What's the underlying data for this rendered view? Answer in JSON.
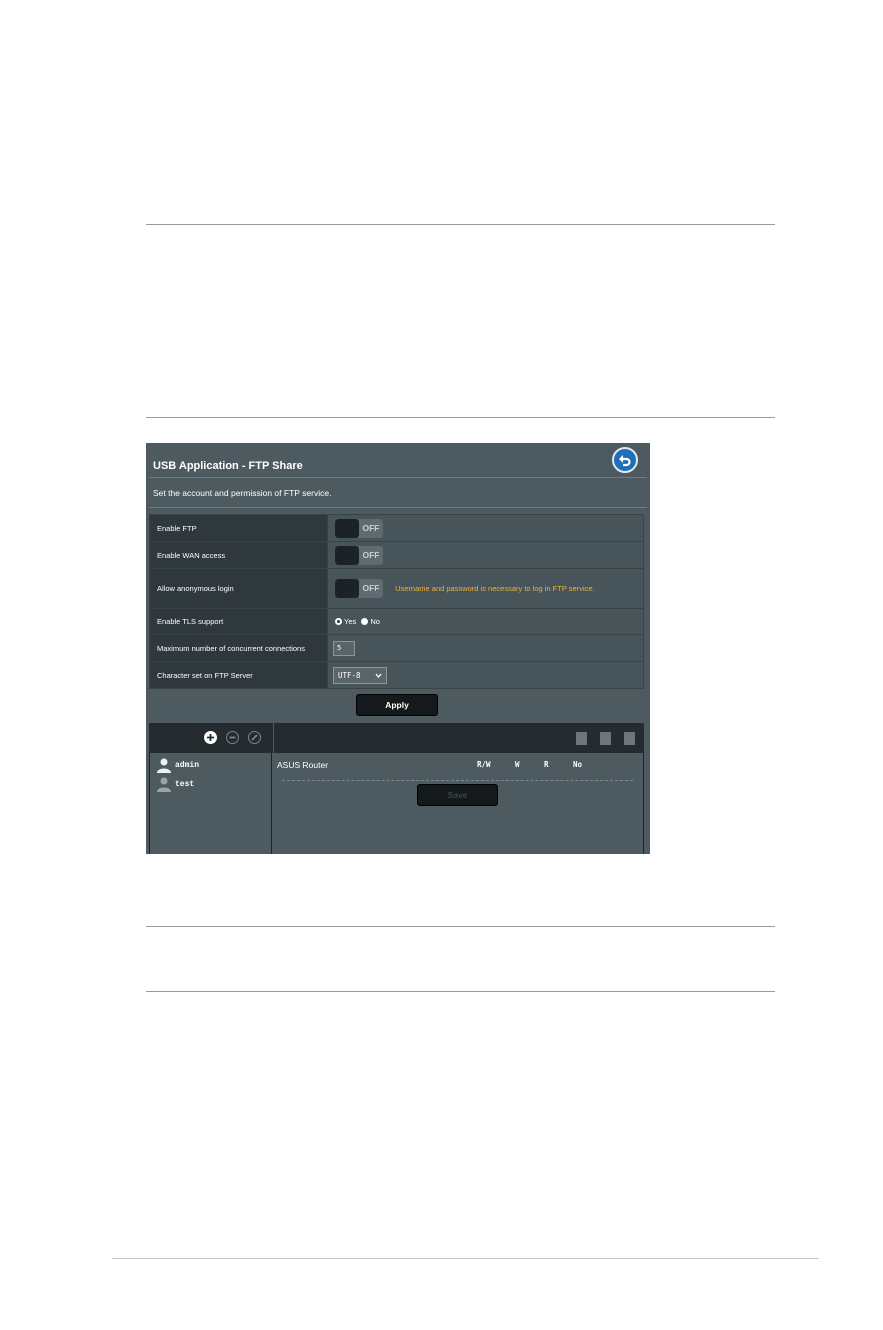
{
  "panel": {
    "title": "USB Application - FTP Share",
    "description": "Set the account and permission of FTP service."
  },
  "settings": {
    "enable_ftp": {
      "label": "Enable FTP",
      "toggle": "OFF"
    },
    "enable_wan": {
      "label": "Enable WAN access",
      "toggle": "OFF"
    },
    "anonymous": {
      "label": "Allow anonymous login",
      "toggle": "OFF",
      "note": "Username and password is necessary to log in FTP service."
    },
    "tls": {
      "label": "Enable TLS support",
      "yes_label": "Yes",
      "no_label": "No",
      "selected": "Yes"
    },
    "max_conn": {
      "label": "Maximum number of concurrent connections",
      "value": "5"
    },
    "charset": {
      "label": "Character set on FTP Server",
      "value": "UTF-8"
    }
  },
  "apply_label": "Apply",
  "accounts": {
    "users": [
      {
        "name": "admin"
      },
      {
        "name": "test"
      }
    ],
    "folder": "ASUS Router",
    "permissions": [
      "R/W",
      "W",
      "R",
      "No"
    ],
    "save_label": "Save"
  },
  "colors": {
    "accent": "#1f6fb8",
    "warning": "#f1b233",
    "panel_bg": "#4d5a60"
  },
  "icons": [
    "back-arrow-icon",
    "add-icon",
    "remove-icon",
    "edit-icon",
    "add-folder-icon",
    "document-icon",
    "edit-document-icon",
    "user-icon"
  ]
}
